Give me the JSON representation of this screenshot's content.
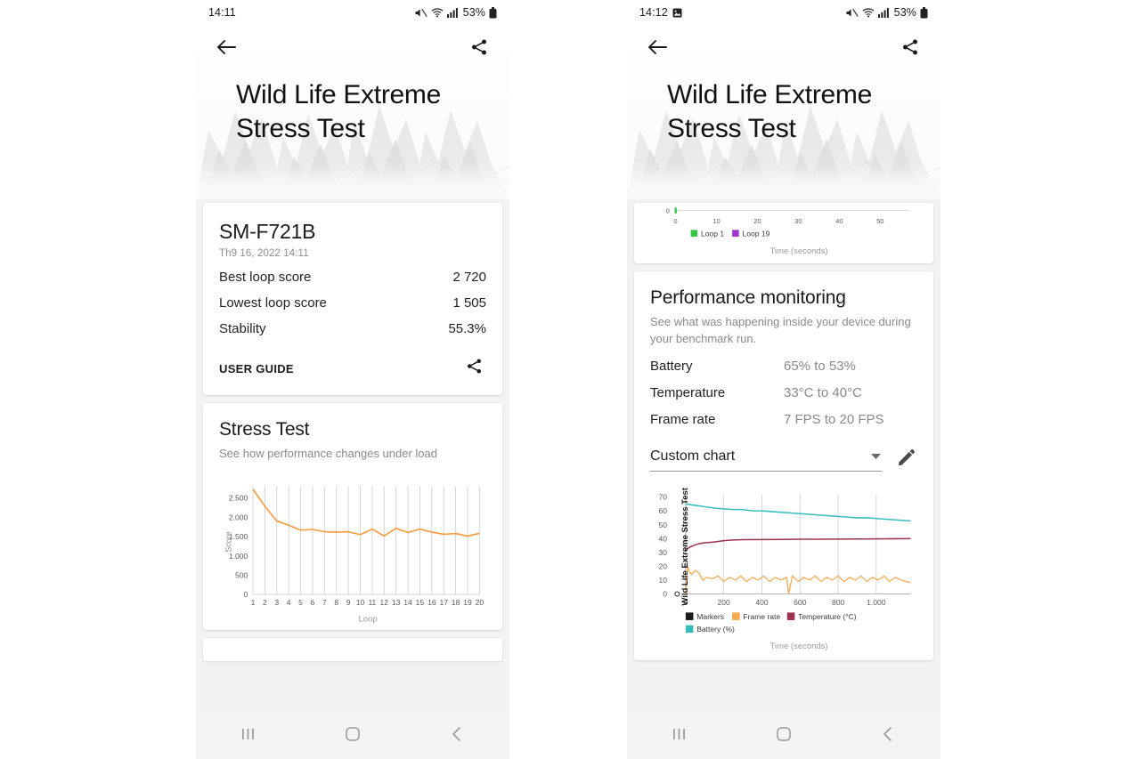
{
  "page": {
    "background": "#ffffff",
    "card_bg": "#ffffff",
    "page_bg": "#f2f2f2"
  },
  "left_phone": {
    "statusbar": {
      "time": "14:11",
      "battery_pct": "53%",
      "icons": [
        "mute-icon",
        "wifi-icon",
        "signal-icon",
        "battery-icon"
      ]
    },
    "header": {
      "title": "Wild Life Extreme\nStress Test",
      "title_line1": "Wild Life Extreme",
      "title_line2": "Stress Test",
      "back_icon": "arrow-left-icon",
      "share_icon": "share-icon"
    },
    "result_card": {
      "device": "SM-F721B",
      "date": "Th9 16, 2022 14:11",
      "rows": [
        {
          "label": "Best loop score",
          "value": "2 720"
        },
        {
          "label": "Lowest loop score",
          "value": "1 505"
        },
        {
          "label": "Stability",
          "value": "55.3%"
        }
      ],
      "user_guide": "USER GUIDE",
      "share_icon": "share-icon"
    },
    "stress_card": {
      "title": "Stress Test",
      "subtitle": "See how performance changes under load"
    },
    "navbar": {
      "recents": "recents-icon",
      "home": "home-icon",
      "back": "back-icon"
    }
  },
  "right_phone": {
    "statusbar": {
      "time": "14:12",
      "screenshot_icon": "image-icon",
      "battery_pct": "53%",
      "icons": [
        "mute-icon",
        "wifi-icon",
        "signal-icon",
        "battery-icon"
      ]
    },
    "header": {
      "title_line1": "Wild Life Extreme",
      "title_line2": "Stress Test",
      "back_icon": "arrow-left-icon",
      "share_icon": "share-icon"
    },
    "loop_card": {
      "legend": [
        {
          "label": "Loop 1",
          "color": "#3bc44a"
        },
        {
          "label": "Loop 19",
          "color": "#9c38c9"
        }
      ],
      "xlabel": "Time (seconds)",
      "xticks": [
        "0",
        "10",
        "20",
        "30",
        "40",
        "50"
      ],
      "ytick_zero": "0"
    },
    "perf_card": {
      "title": "Performance monitoring",
      "subtitle": "See what was happening inside your device during your benchmark run.",
      "rows": [
        {
          "label": "Battery",
          "value": "65% to 53%"
        },
        {
          "label": "Temperature",
          "value": "33°C to 40°C"
        },
        {
          "label": "Frame rate",
          "value": "7 FPS to 20 FPS"
        }
      ],
      "select_value": "Custom chart",
      "dropdown_icon": "chevron-down-icon",
      "edit_icon": "pencil-icon"
    },
    "navbar": {
      "recents": "recents-icon",
      "home": "home-icon",
      "back": "back-icon"
    }
  },
  "chart_data": [
    {
      "id": "stress_test_loop_chart",
      "type": "line",
      "title": "Stress Test",
      "subtitle": "See how performance changes under load",
      "xlabel": "Loop",
      "ylabel": "Score",
      "xticks": [
        "1",
        "2",
        "3",
        "4",
        "5",
        "6",
        "7",
        "8",
        "9",
        "10",
        "11",
        "12",
        "13",
        "14",
        "15",
        "16",
        "17",
        "18",
        "19",
        "20"
      ],
      "yticks": [
        "0",
        "500",
        "1.000",
        "1.500",
        "2.000",
        "2.500"
      ],
      "ylim": [
        0,
        2800
      ],
      "xlim": [
        1,
        20
      ],
      "grid": "vertical",
      "series": [
        {
          "name": "Score",
          "color": "#f59a3e",
          "x": [
            1,
            2,
            3,
            4,
            5,
            6,
            7,
            8,
            9,
            10,
            11,
            12,
            13,
            14,
            15,
            16,
            17,
            18,
            19,
            20
          ],
          "values": [
            2720,
            2280,
            1900,
            1790,
            1660,
            1680,
            1620,
            1610,
            1620,
            1545,
            1690,
            1510,
            1710,
            1600,
            1690,
            1610,
            1555,
            1575,
            1505,
            1580
          ]
        }
      ]
    },
    {
      "id": "loop_frametime_chart_partial",
      "type": "line",
      "xlabel": "Time (seconds)",
      "xticks": [
        "0",
        "10",
        "20",
        "30",
        "40",
        "50"
      ],
      "xlim": [
        0,
        57
      ],
      "legend_position": "below-axis",
      "series": [
        {
          "name": "Loop 1",
          "color": "#3bc44a",
          "values": []
        },
        {
          "name": "Loop 19",
          "color": "#9c38c9",
          "values": []
        }
      ]
    },
    {
      "id": "custom_performance_chart",
      "type": "line",
      "xlabel": "Time (seconds)",
      "ylabel": "Wild Life Extreme Stress Test",
      "xticks": [
        "0",
        "200",
        "400",
        "600",
        "800",
        "1.000"
      ],
      "yticks": [
        "0",
        "10",
        "20",
        "30",
        "40",
        "50",
        "60",
        "70"
      ],
      "ylim": [
        0,
        72
      ],
      "xlim": [
        0,
        1180
      ],
      "grid": "vertical",
      "legend": [
        {
          "name": "Markers",
          "color": "#1a1a1a"
        },
        {
          "name": "Frame rate",
          "color": "#f5a84e"
        },
        {
          "name": "Temperature (°C)",
          "color": "#a03050"
        },
        {
          "name": "Battery (%)",
          "color": "#36bcbc"
        }
      ],
      "series": [
        {
          "name": "Battery (%)",
          "color": "#36bcbc",
          "x": [
            0,
            50,
            100,
            150,
            200,
            250,
            300,
            350,
            400,
            450,
            500,
            550,
            600,
            650,
            700,
            750,
            800,
            850,
            900,
            950,
            1000,
            1050,
            1100,
            1150,
            1180
          ],
          "values": [
            65,
            64,
            63,
            62,
            61.5,
            61,
            61,
            60,
            60,
            59.5,
            59,
            58.5,
            58,
            57.5,
            57,
            56.5,
            56,
            55.5,
            55,
            55,
            54.5,
            54,
            53.5,
            53,
            52.8
          ]
        },
        {
          "name": "Temperature (°C)",
          "color": "#a03050",
          "x": [
            0,
            25,
            50,
            75,
            100,
            150,
            200,
            250,
            300,
            400,
            500,
            600,
            700,
            800,
            900,
            1000,
            1100,
            1180
          ],
          "values": [
            32,
            34,
            35.5,
            36.5,
            37,
            37.5,
            38.5,
            39,
            39.2,
            39.3,
            39.4,
            39.5,
            39.5,
            39.6,
            39.7,
            39.8,
            39.9,
            40
          ]
        },
        {
          "name": "Frame rate",
          "color": "#f5a84e",
          "x": [
            0,
            10,
            20,
            30,
            50,
            70,
            90,
            110,
            140,
            170,
            200,
            230,
            260,
            290,
            320,
            350,
            380,
            410,
            440,
            470,
            500,
            530,
            540,
            560,
            590,
            620,
            650,
            680,
            710,
            740,
            770,
            800,
            830,
            860,
            890,
            920,
            950,
            980,
            1010,
            1040,
            1070,
            1100,
            1130,
            1160,
            1180
          ],
          "values": [
            0,
            20,
            16,
            14,
            17,
            15,
            10,
            12,
            11,
            13,
            9,
            12,
            10,
            13,
            9,
            12,
            10,
            13,
            9,
            12,
            10,
            12,
            0,
            13,
            9,
            12,
            10,
            13,
            9,
            12,
            10,
            13,
            9,
            12,
            10,
            13,
            9,
            12,
            10,
            13,
            9,
            12,
            10,
            9,
            8
          ]
        }
      ]
    }
  ]
}
